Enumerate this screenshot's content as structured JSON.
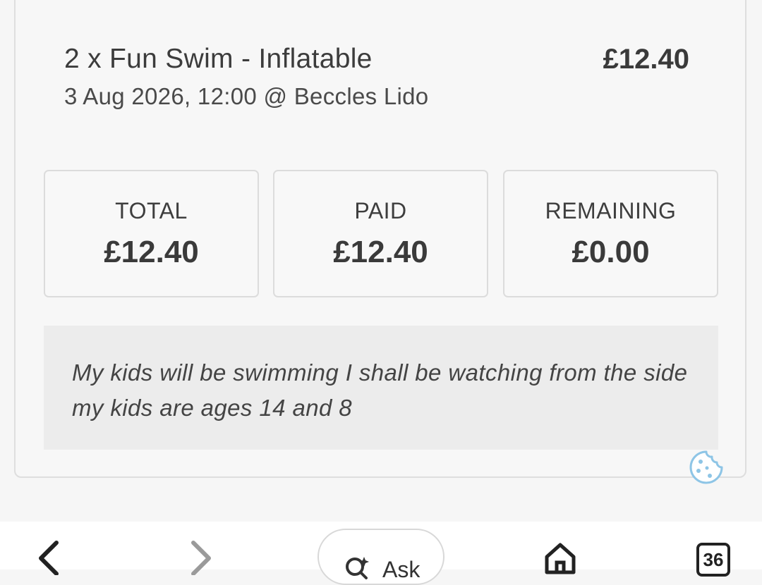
{
  "booking": {
    "item_title": "2 x Fun Swim - Inflatable",
    "item_details": "3 Aug 2026, 12:00 @ Beccles Lido",
    "item_price": "£12.40"
  },
  "summary": {
    "total_label": "TOTAL",
    "total_value": "£12.40",
    "paid_label": "PAID",
    "paid_value": "£12.40",
    "remaining_label": "REMAINING",
    "remaining_value": "£0.00"
  },
  "note": {
    "text": "My kids will be swimming I shall be watching from the side my kids are ages 14 and 8"
  },
  "browser_bar": {
    "ask_label": "Ask",
    "tab_count": "36"
  },
  "colors": {
    "cookie_icon": "#8ec5e6",
    "note_background": "#ececec"
  },
  "icons": [
    "cookie-icon",
    "back-arrow-icon",
    "forward-arrow-icon",
    "ask-sparkle-search-icon",
    "home-icon",
    "tabs-icon"
  ]
}
